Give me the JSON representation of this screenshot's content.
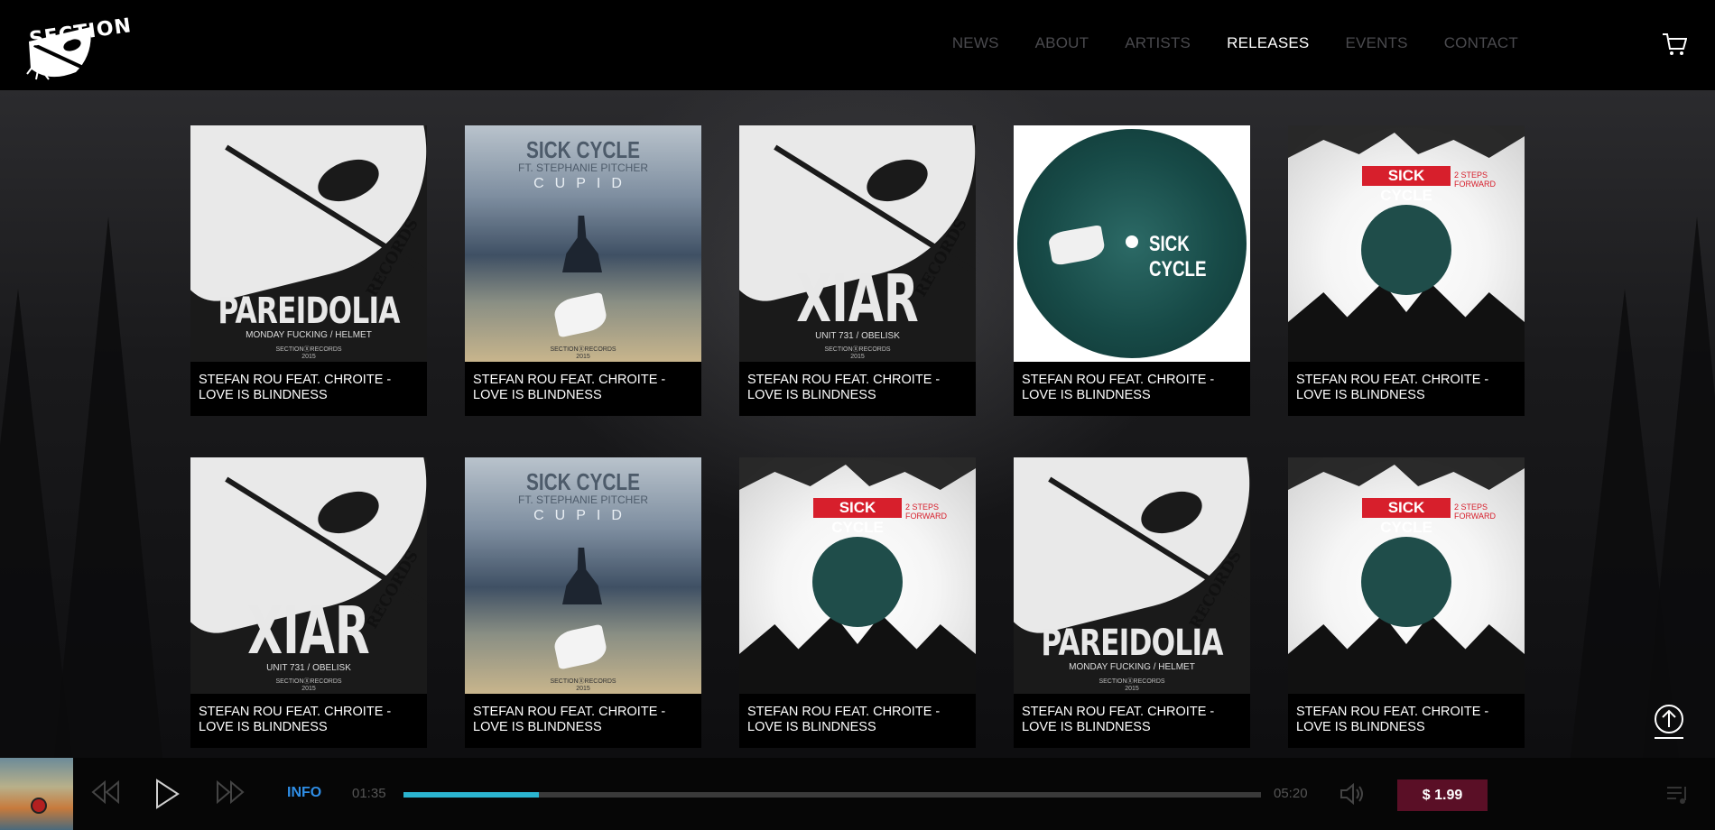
{
  "colors": {
    "background": "#0b0b0c",
    "nav_inactive": "#4a4a4e",
    "nav_active": "#ffffff",
    "accent_info": "#2f8ee6",
    "progress_fill": "#2bb4cf",
    "price_button": "#5a0f26"
  },
  "header": {
    "logo_text": "SECTION",
    "nav": [
      {
        "label": "NEWS",
        "active": false
      },
      {
        "label": "ABOUT",
        "active": false
      },
      {
        "label": "ARTISTS",
        "active": false
      },
      {
        "label": "RELEASES",
        "active": true
      },
      {
        "label": "EVENTS",
        "active": false
      },
      {
        "label": "CONTACT",
        "active": false
      }
    ],
    "cart_icon": "cart-icon"
  },
  "covers": {
    "pareidolia": {
      "title": "PAREIDOLIA",
      "sub": "MONDAY FUCKING / HELMET",
      "foot": "SECTIONⓍRECORDS",
      "year": "2015",
      "records": "RECORDS"
    },
    "xiar": {
      "title": "XIAR",
      "sub": "UNIT 731 / OBELISK",
      "foot": "SECTIONⓍRECORDS",
      "year": "2015",
      "records": "RECORDS"
    },
    "cupid": {
      "title": "SICK CYCLE",
      "feat": "FT. STEPHANIE PITCHER",
      "name": "CUPID",
      "foot": "SECTIONⓍRECORDS",
      "year": "2015"
    },
    "vinyl": {
      "title": "SICK CYCLE"
    },
    "steps": {
      "title": "SICK CYCLE",
      "sub": "2 STEPS FORWARD"
    }
  },
  "releases": [
    {
      "cover": "pareidolia",
      "title": "STEFAN ROU FEAT. CHROITE - LOVE IS BLINDNESS"
    },
    {
      "cover": "cupid",
      "title": "STEFAN ROU FEAT. CHROITE - LOVE IS BLINDNESS"
    },
    {
      "cover": "xiar",
      "title": "STEFAN ROU FEAT. CHROITE - LOVE IS BLINDNESS"
    },
    {
      "cover": "vinyl",
      "title": "STEFAN ROU FEAT. CHROITE - LOVE IS BLINDNESS"
    },
    {
      "cover": "steps",
      "title": "STEFAN ROU FEAT. CHROITE - LOVE IS BLINDNESS"
    },
    {
      "cover": "xiar",
      "title": "STEFAN ROU FEAT. CHROITE - LOVE IS BLINDNESS"
    },
    {
      "cover": "cupid",
      "title": "STEFAN ROU FEAT. CHROITE - LOVE IS BLINDNESS"
    },
    {
      "cover": "steps",
      "title": "STEFAN ROU FEAT. CHROITE - LOVE IS BLINDNESS"
    },
    {
      "cover": "pareidolia",
      "title": "STEFAN ROU FEAT. CHROITE - LOVE IS BLINDNESS"
    },
    {
      "cover": "steps",
      "title": "STEFAN ROU FEAT. CHROITE - LOVE IS BLINDNESS"
    }
  ],
  "player": {
    "info_label": "INFO",
    "current_time": "01:35",
    "total_time": "05:20",
    "progress_fraction": 0.158,
    "price_label": "$ 1.99"
  }
}
